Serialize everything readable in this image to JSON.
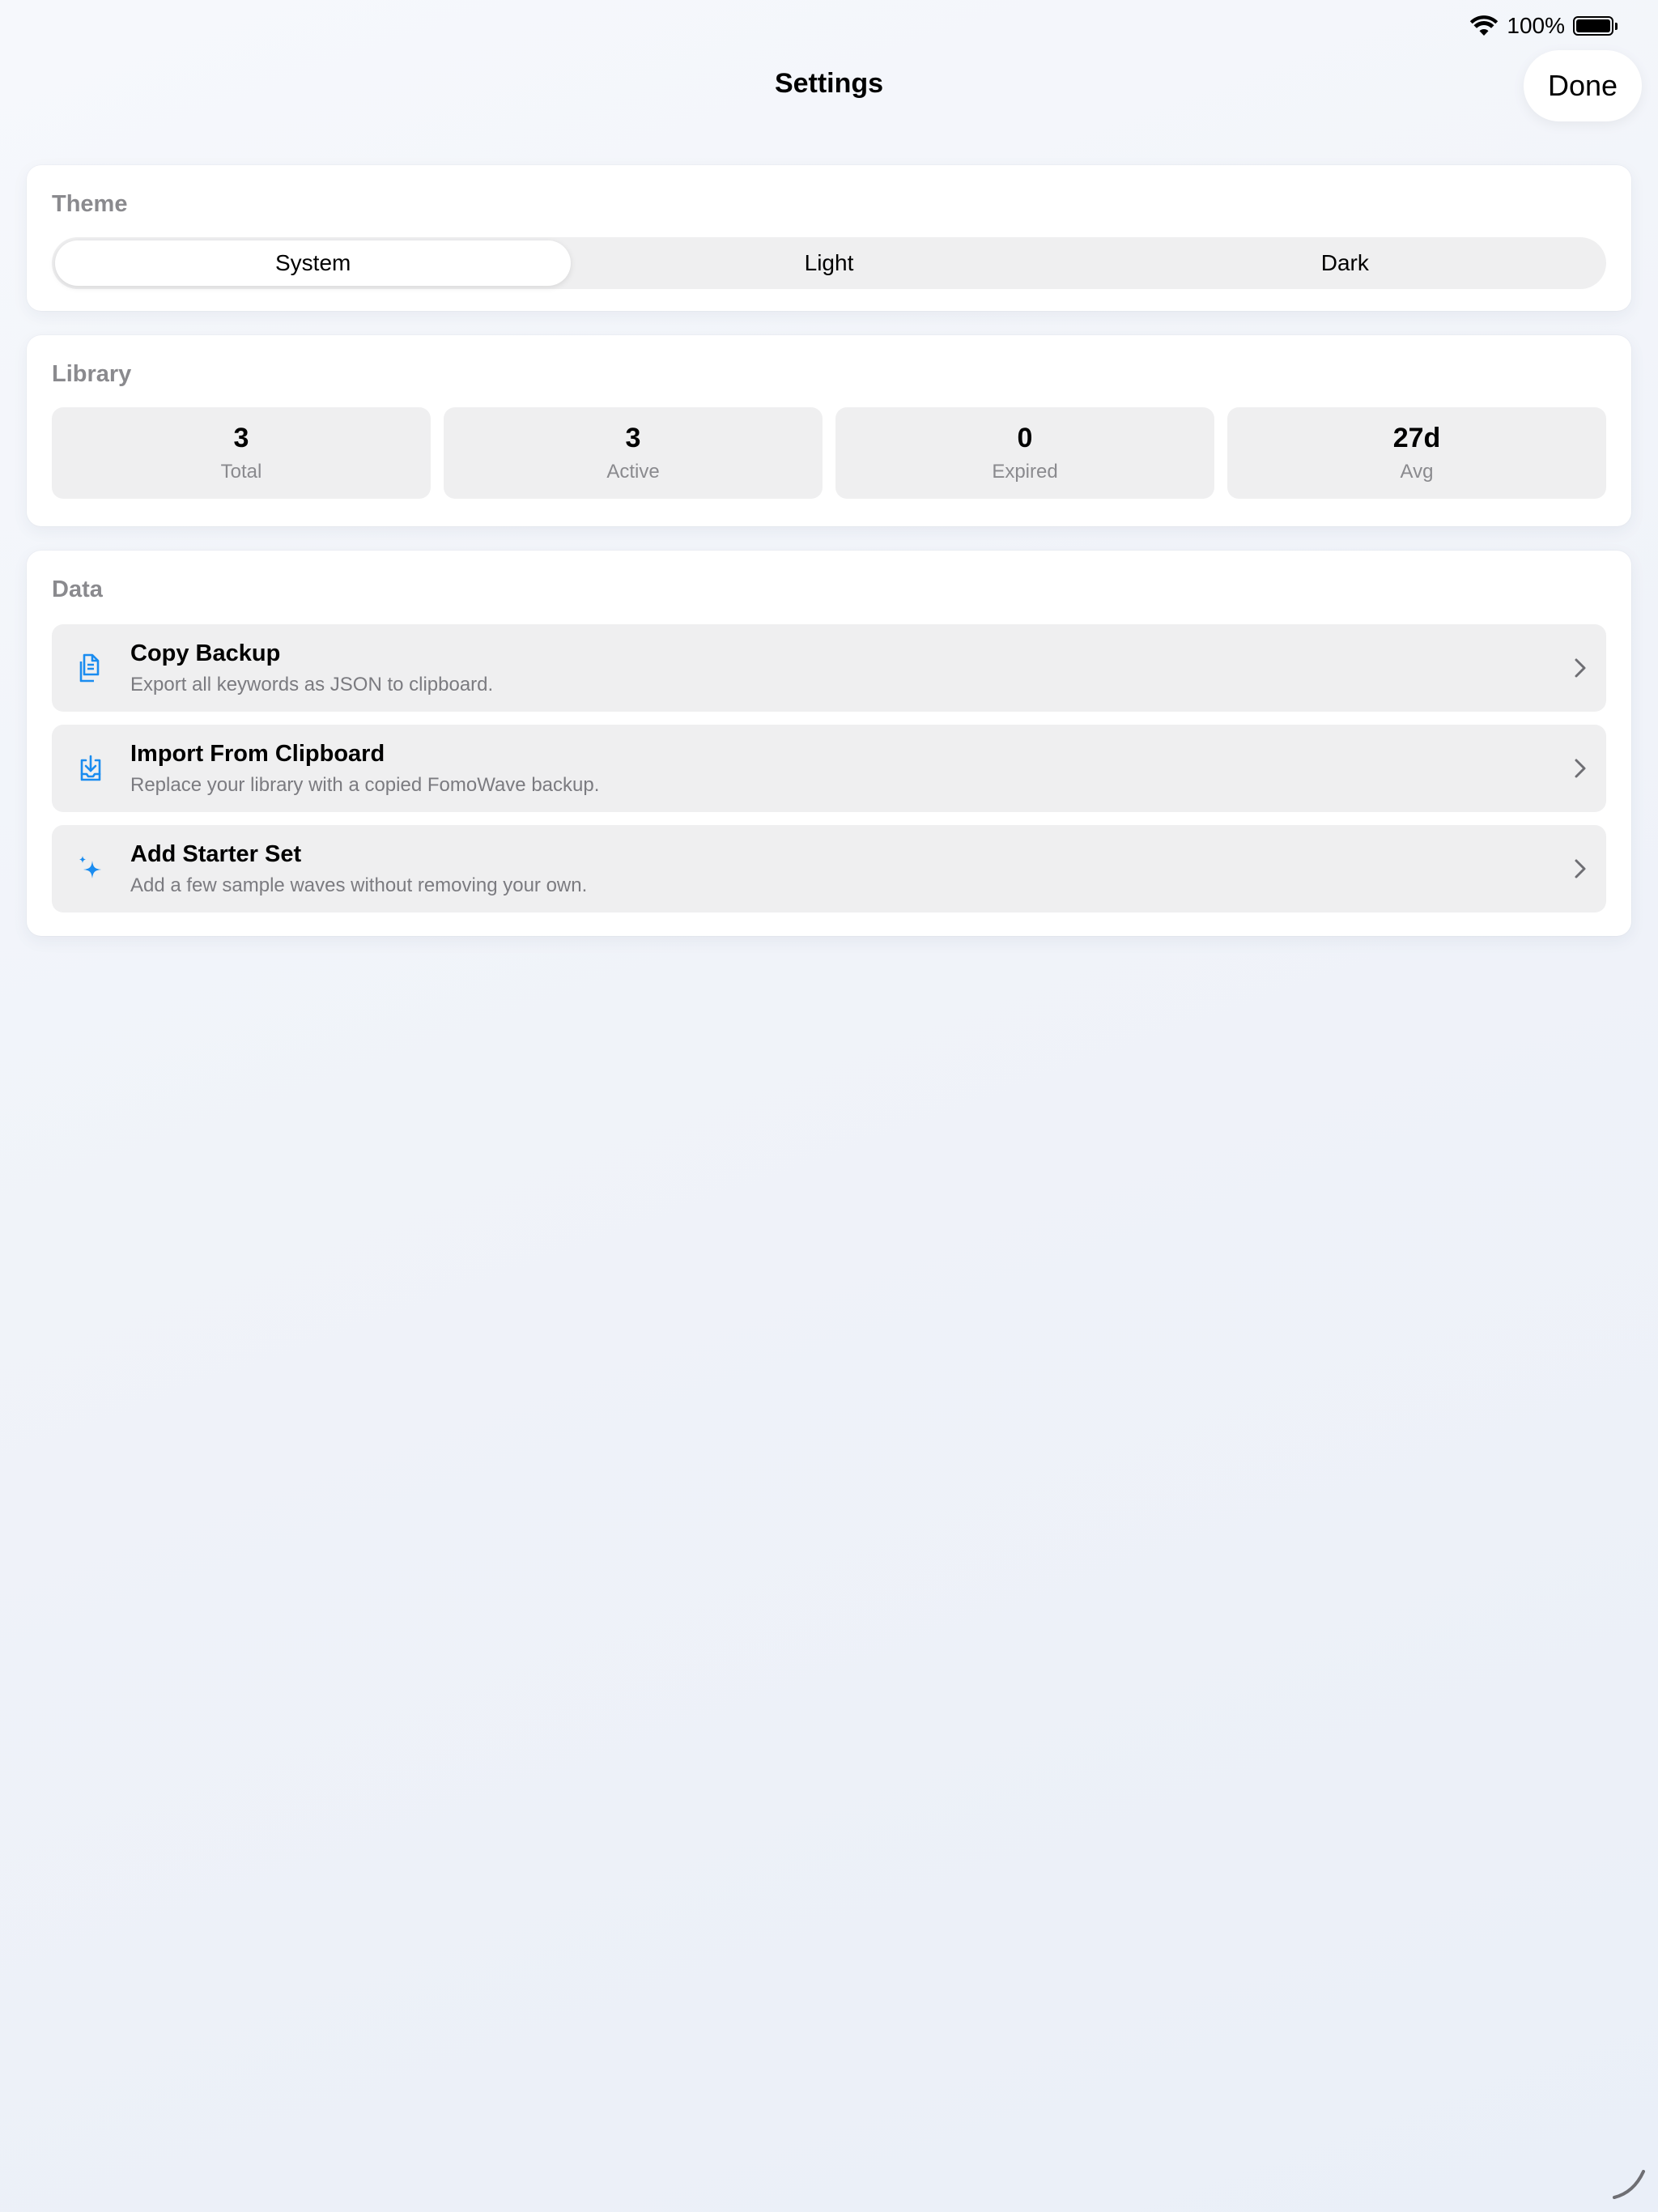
{
  "status": {
    "battery_percent": "100%",
    "battery_level": 1.0
  },
  "nav": {
    "title": "Settings",
    "done_label": "Done"
  },
  "theme": {
    "header": "Theme",
    "options": [
      "System",
      "Light",
      "Dark"
    ],
    "selected": "System"
  },
  "library": {
    "header": "Library",
    "stats": [
      {
        "value": "3",
        "label": "Total"
      },
      {
        "value": "3",
        "label": "Active"
      },
      {
        "value": "0",
        "label": "Expired"
      },
      {
        "value": "27d",
        "label": "Avg"
      }
    ]
  },
  "data_section": {
    "header": "Data",
    "rows": [
      {
        "icon": "copy-document-icon",
        "title": "Copy Backup",
        "subtitle": "Export all keywords as JSON to clipboard."
      },
      {
        "icon": "import-tray-icon",
        "title": "Import From Clipboard",
        "subtitle": "Replace your library with a copied FomoWave backup."
      },
      {
        "icon": "sparkles-icon",
        "title": "Add Starter Set",
        "subtitle": "Add a few sample waves without removing your own."
      }
    ]
  },
  "colors": {
    "accent": "#1a8cf0",
    "segment_bg": "#efeff0",
    "secondary_text": "#8a8a8e"
  }
}
